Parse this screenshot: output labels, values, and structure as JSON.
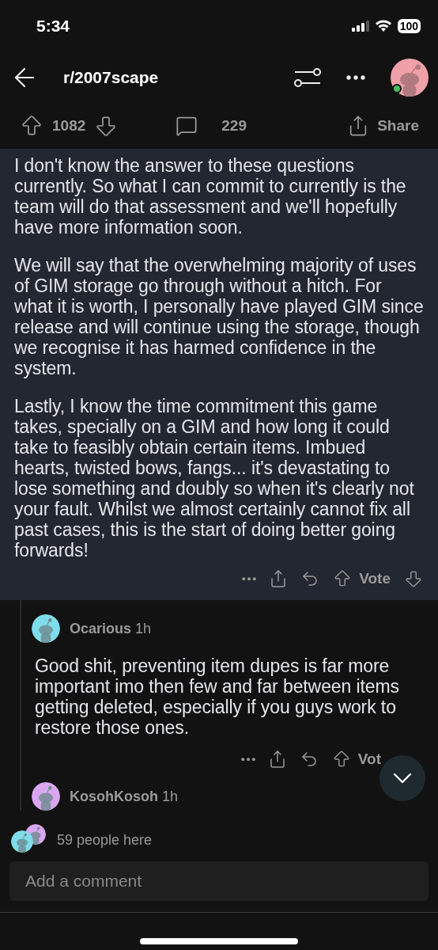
{
  "status_bar": {
    "time": "5:34",
    "battery": "100"
  },
  "header": {
    "title": "r/2007scape"
  },
  "post_actions": {
    "score": "1082",
    "comments": "229",
    "share": "Share"
  },
  "post_body": {
    "paragraphs": [
      "I don't know the answer to these questions currently. So what I can commit to currently is the team will do that assessment and we'll hopefully have more information soon.",
      "We will say that the overwhelming majority of uses of GIM storage go through without a hitch. For what it is worth, I personally have played GIM since release and will continue using the storage, though we recognise it has harmed confidence in the system.",
      "Lastly, I know the time commitment this game takes, specially on a GIM and how long it could take to feasibly obtain certain items. Imbued hearts, twisted bows, fangs... it's devastating to lose something and doubly so when it's clearly not your fault. Whilst we almost certainly cannot fix all past cases, this is the start of doing better going forwards!"
    ],
    "vote": "Vote"
  },
  "comments": [
    {
      "author": "Ocarious",
      "time": "1h",
      "color": "#7fdcea",
      "text": "Good shit, preventing item dupes is far more important imo then few and far between items getting deleted, especially if you guys work to restore those ones.",
      "vote": "Vot"
    },
    {
      "author": "KosohKosoh",
      "time": "1h",
      "color": "#d9a6f0"
    }
  ],
  "presence": {
    "text": "59 people here"
  },
  "composer": {
    "placeholder": "Add a comment"
  }
}
